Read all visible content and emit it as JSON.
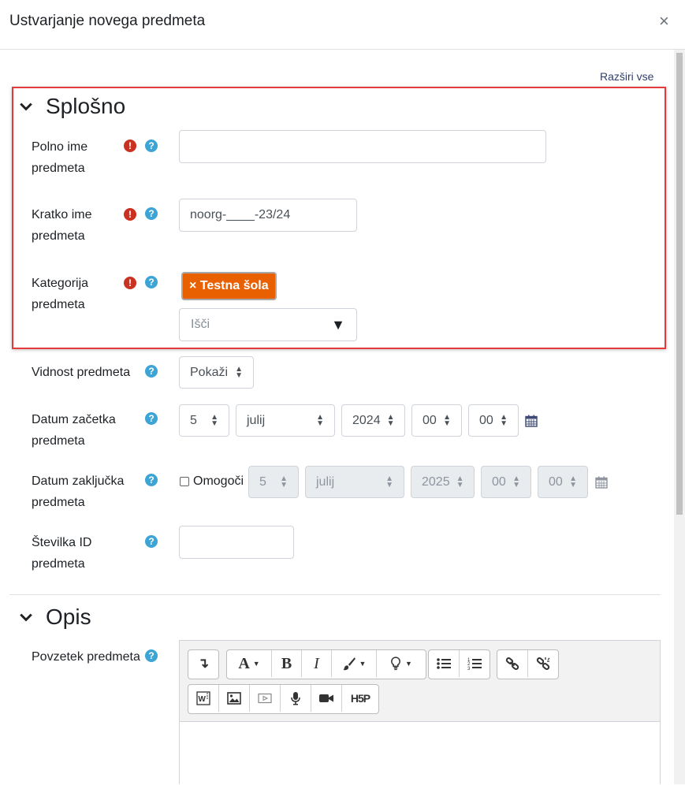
{
  "modal": {
    "title": "Ustvarjanje novega predmeta",
    "close_label": "×",
    "expand_all": "Razširi vse"
  },
  "general": {
    "title": "Splošno",
    "fullname": {
      "label": "Polno ime predmeta",
      "value": ""
    },
    "shortname": {
      "label": "Kratko ime predmeta",
      "value": "noorg-____-23/24"
    },
    "category": {
      "label": "Kategorija predmeta",
      "selected": "× Testna šola",
      "search_placeholder": "Išči",
      "search_arrow": "▼"
    },
    "visibility": {
      "label": "Vidnost predmeta",
      "value": "Pokaži"
    },
    "startdate": {
      "label": "Datum začetka predmeta",
      "day": "5",
      "month": "julij",
      "year": "2024",
      "hour": "00",
      "minute": "00"
    },
    "enddate": {
      "label": "Datum zaključka predmeta",
      "enable_label": "Omogoči",
      "enabled": false,
      "day": "5",
      "month": "julij",
      "year": "2025",
      "hour": "00",
      "minute": "00"
    },
    "idnumber": {
      "label": "Številka ID predmeta",
      "value": ""
    }
  },
  "description": {
    "title": "Opis",
    "summary": {
      "label": "Povzetek predmeta"
    },
    "toolbar": {
      "collapse": "↴",
      "font": "A",
      "bold": "B",
      "italic": "I",
      "row2_h5p": "H5P"
    }
  },
  "icons": {
    "required": "exclamation-circle-icon",
    "help": "question-circle-icon",
    "calendar": "calendar-icon"
  },
  "colors": {
    "required": "#ca3120",
    "help": "#3ca5d6",
    "badge": "#e86000",
    "highlight": "#e53a3a"
  }
}
